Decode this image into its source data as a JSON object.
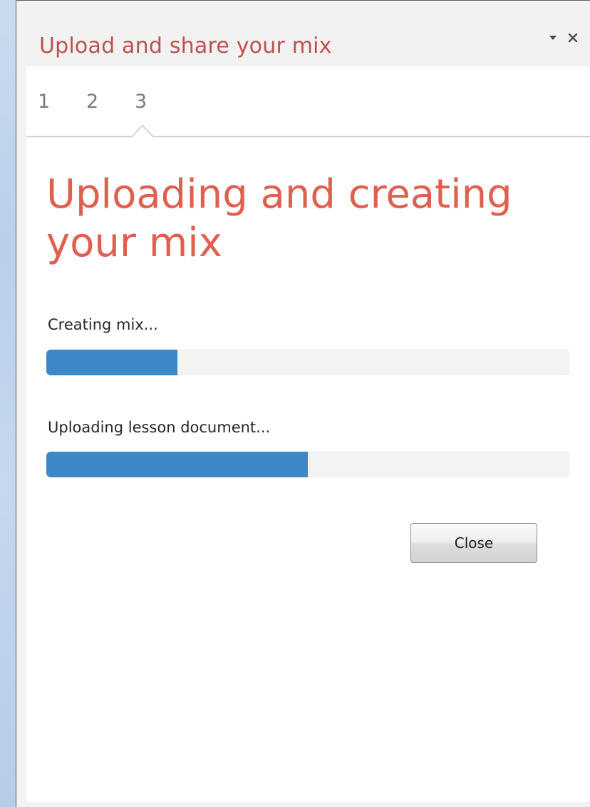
{
  "pane": {
    "title": "Upload and share your mix",
    "dropdown_icon": "triangle-down-icon",
    "close_icon": "close-icon"
  },
  "steps": [
    {
      "label": "1"
    },
    {
      "label": "2"
    },
    {
      "label": "3",
      "active": true
    }
  ],
  "heading": "Uploading and creating your mix",
  "progress": [
    {
      "label": "Creating mix...",
      "percent": 25
    },
    {
      "label": "Uploading lesson document...",
      "percent": 50
    }
  ],
  "footer": {
    "close_label": "Close"
  },
  "colors": {
    "accent": "#c0504d",
    "heading": "#e0604f",
    "progress_fill": "#3f88c8",
    "progress_track": "#f3f3f3"
  }
}
